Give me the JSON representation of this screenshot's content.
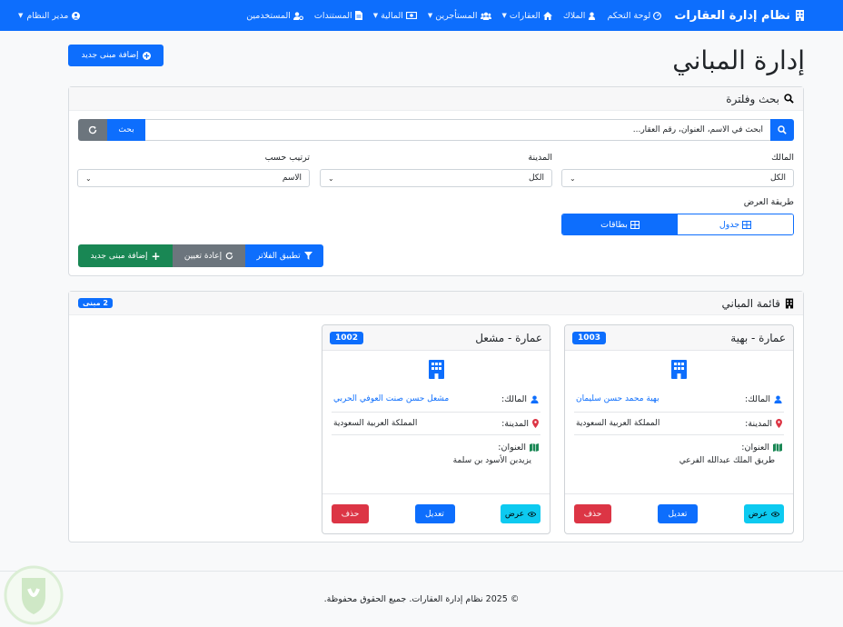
{
  "navbar": {
    "brand": "نظام إدارة العقارات",
    "items": [
      {
        "label": "لوحة التحكم",
        "icon": "gauge-icon",
        "dropdown": false
      },
      {
        "label": "الملاك",
        "icon": "user-tie-icon",
        "dropdown": false
      },
      {
        "label": "العقارات",
        "icon": "home-icon",
        "dropdown": true
      },
      {
        "label": "المستأجرين",
        "icon": "users-icon",
        "dropdown": true
      },
      {
        "label": "المالية",
        "icon": "money-icon",
        "dropdown": true
      },
      {
        "label": "المستندات",
        "icon": "file-icon",
        "dropdown": false
      },
      {
        "label": "المستخدمين",
        "icon": "users-cog-icon",
        "dropdown": false
      }
    ],
    "user": "مدير النظام"
  },
  "page": {
    "title": "إدارة المباني",
    "add_button": "إضافة مبنى جديد"
  },
  "filter": {
    "header": "بحث وفلترة",
    "search_placeholder": "ابحث في الاسم، العنوان، رقم العقار...",
    "search_button": "بحث",
    "owner_label": "المالك",
    "owner_value": "الكل",
    "city_label": "المدينة",
    "city_value": "الكل",
    "sort_label": "ترتيب حسب",
    "sort_value": "الاسم",
    "view_label": "طريقة العرض",
    "view_table": "جدول",
    "view_cards": "بطاقات",
    "apply_button": "تطبيق الفلاتر",
    "reset_button": "إعادة تعيين",
    "add_button": "إضافة مبنى جديد"
  },
  "list": {
    "header": "قائمة المباني",
    "count_badge": "2 مبنى",
    "owner_label": "المالك:",
    "city_label": "المدينة:",
    "address_label": "العنوان:",
    "view_label": "عرض",
    "edit_label": "تعديل",
    "delete_label": "حذف",
    "buildings": [
      {
        "id": "1003",
        "name": "عمارة - بهية",
        "owner": "بهية محمد حسن سليمان",
        "city": "المملكة العربية السعودية",
        "address": "طريق الملك عبدالله الفرعي"
      },
      {
        "id": "1002",
        "name": "عمارة - مشعل",
        "owner": "مشعل حسن صنت العوفي الحربي",
        "city": "المملكة العربية السعودية",
        "address": "يزيدبن الأسود بن سلمة"
      }
    ]
  },
  "footer": {
    "text": "© 2025 نظام إدارة العقارات. جميع الحقوق محفوظة."
  },
  "colors": {
    "primary": "#0d6efd",
    "secondary": "#6c757d",
    "success": "#198754",
    "danger": "#dc3545",
    "info": "#0dcaf0"
  }
}
